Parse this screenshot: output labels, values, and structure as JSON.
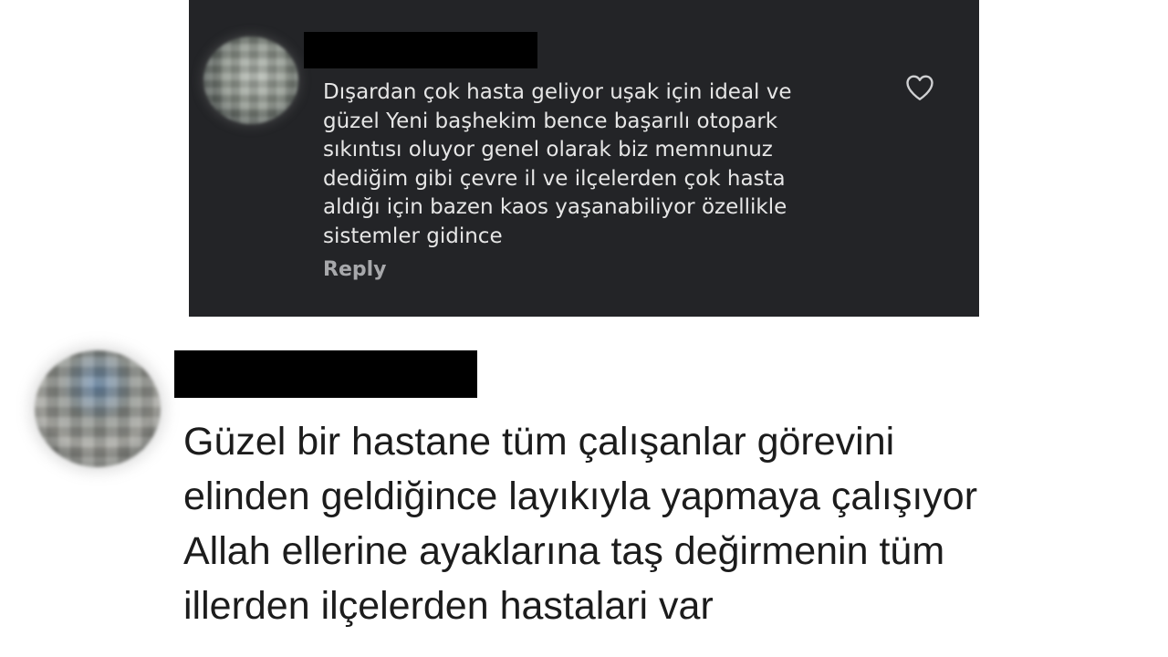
{
  "top_comment": {
    "avatar_icon": "user-avatar-blurred",
    "text": "Dışardan çok hasta geliyor uşak için ideal ve\ngüzel Yeni başhekim bence başarılı otopark\nsıkıntısı oluyor genel olarak biz memnunuz\ndediğim gibi çevre il ve ilçelerden çok hasta\naldığı için bazen kaos yaşanabiliyor özellikle\nsistemler gidince",
    "reply_label": "Reply",
    "like_icon": "heart-outline-icon",
    "background_color": "#232427"
  },
  "bottom_comment": {
    "avatar_icon": "user-avatar-blurred",
    "text": "Güzel bir hastane tüm çalışanlar görevini\nelinden geldiğince layıkıyla yapmaya çalışıyor\nAllah ellerine ayaklarına taş değirmenin tüm\nillerden ilçelerden hastalari var",
    "background_color": "#ffffff"
  }
}
